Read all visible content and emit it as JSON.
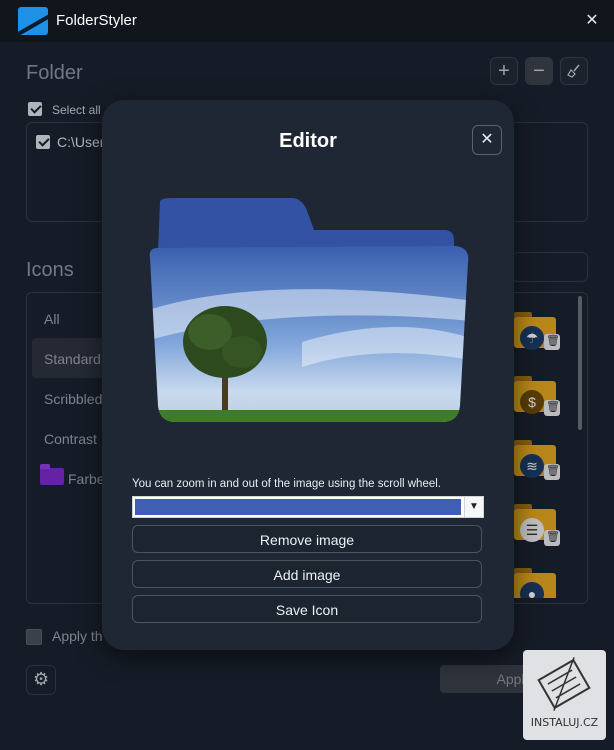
{
  "window": {
    "title": "FolderStyler",
    "close_icon": "close-icon"
  },
  "folder_section": {
    "title": "Folder",
    "add_label": "+",
    "remove_label": "−",
    "select_all_label": "Select all",
    "select_all_checked": true,
    "paths": [
      {
        "text": "C:\\User",
        "checked": true
      }
    ]
  },
  "icons_section": {
    "title": "Icons",
    "categories": [
      "All",
      "Standard",
      "Scribbled",
      "Contrast",
      "Farbe"
    ],
    "selected_category": "Standard",
    "preview_icons": [
      "umbrella-icon",
      "dollar-icon",
      "wifi-icon",
      "sliders-icon",
      "person-icon"
    ]
  },
  "bottom": {
    "apply_text_partial": "Apply th",
    "apply_button": "Apply",
    "checked": false
  },
  "editor": {
    "title": "Editor",
    "hint": "You can zoom in and out of the image using the scroll wheel.",
    "buttons": {
      "remove": "Remove image",
      "add": "Add image",
      "save": "Save Icon"
    },
    "accent": "#3f5fb5"
  },
  "watermark": {
    "text": "INSTALUJ.CZ"
  }
}
